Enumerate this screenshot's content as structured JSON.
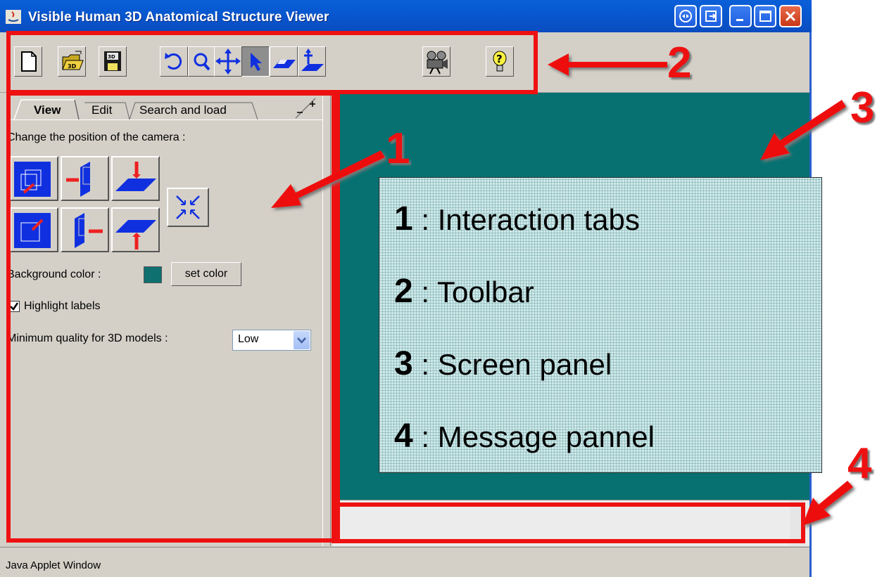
{
  "window": {
    "title": "Visible Human 3D Anatomical Structure Viewer",
    "status_text": "Java Applet Window"
  },
  "toolbar": {
    "buttons": [
      {
        "icon": "new-file-icon"
      },
      {
        "icon": "open-3d-folder-icon"
      },
      {
        "icon": "save-3d-icon"
      },
      {
        "icon": "rotate-icon"
      },
      {
        "icon": "zoom-icon"
      },
      {
        "icon": "pan-icon"
      },
      {
        "icon": "pointer-icon",
        "pressed": true
      },
      {
        "icon": "plane-icon"
      },
      {
        "icon": "plane-translate-icon"
      },
      {
        "icon": "movie-camera-icon"
      },
      {
        "icon": "help-icon"
      }
    ]
  },
  "tabs": [
    {
      "label": "View",
      "active": true
    },
    {
      "label": "Edit"
    },
    {
      "label": "Search and load"
    }
  ],
  "view_tab": {
    "camera_label": "Change the position of the camera :",
    "background_label": "Background color :",
    "background_color": "#0f7070",
    "set_color_label": "set color",
    "highlight_label": "Highlight labels",
    "highlight_checked": true,
    "quality_label": "Minimum quality for 3D models :",
    "quality_value": "Low"
  },
  "legend": {
    "items": [
      {
        "num": "1",
        "text": ": Interaction tabs"
      },
      {
        "num": "2",
        "text": ": Toolbar"
      },
      {
        "num": "3",
        "text": ": Screen panel"
      },
      {
        "num": "4",
        "text": ": Message pannel"
      }
    ]
  },
  "annotations": {
    "n1": "1",
    "n2": "2",
    "n3": "3",
    "n4": "4",
    "color": "#ee1111"
  },
  "colors": {
    "screen_bg": "#077171",
    "titlebar": "#0a5fd8"
  }
}
